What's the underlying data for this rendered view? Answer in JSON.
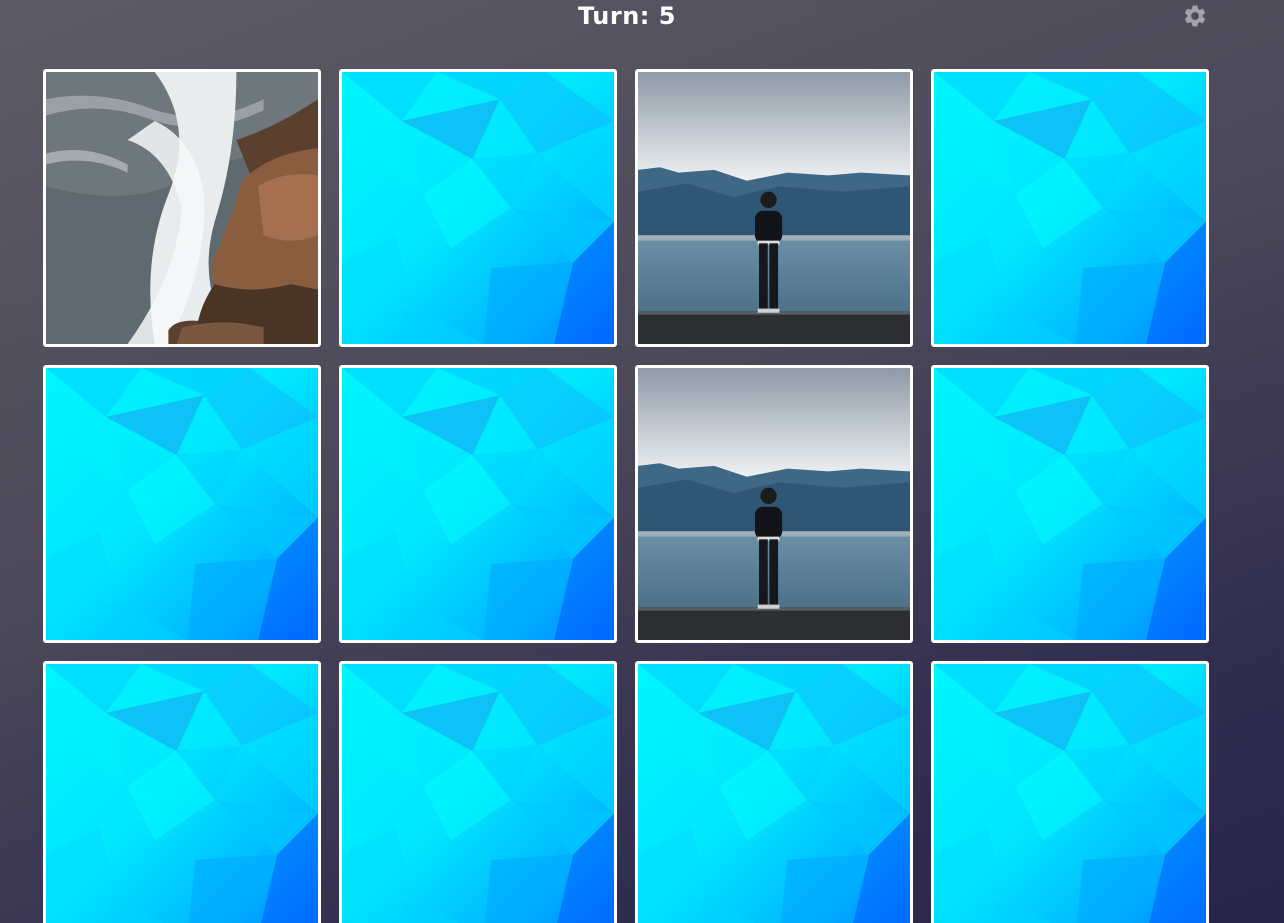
{
  "game": {
    "turn_text": "Turn: 5"
  },
  "icons": {
    "settings": "gear-icon"
  },
  "colors": {
    "card_back_light": "#00f6ff",
    "card_back_dark": "#0050ff",
    "card_border": "#ffffff"
  },
  "board": {
    "columns": 4,
    "cards": [
      {
        "state": "face-up",
        "image": "ocean-waves-rock"
      },
      {
        "state": "face-down"
      },
      {
        "state": "face-up",
        "image": "man-by-lake-mountains"
      },
      {
        "state": "face-down"
      },
      {
        "state": "face-down"
      },
      {
        "state": "face-down"
      },
      {
        "state": "face-up",
        "image": "man-by-lake-mountains"
      },
      {
        "state": "face-down"
      },
      {
        "state": "face-down"
      },
      {
        "state": "face-down"
      },
      {
        "state": "face-down"
      },
      {
        "state": "face-down"
      }
    ]
  }
}
